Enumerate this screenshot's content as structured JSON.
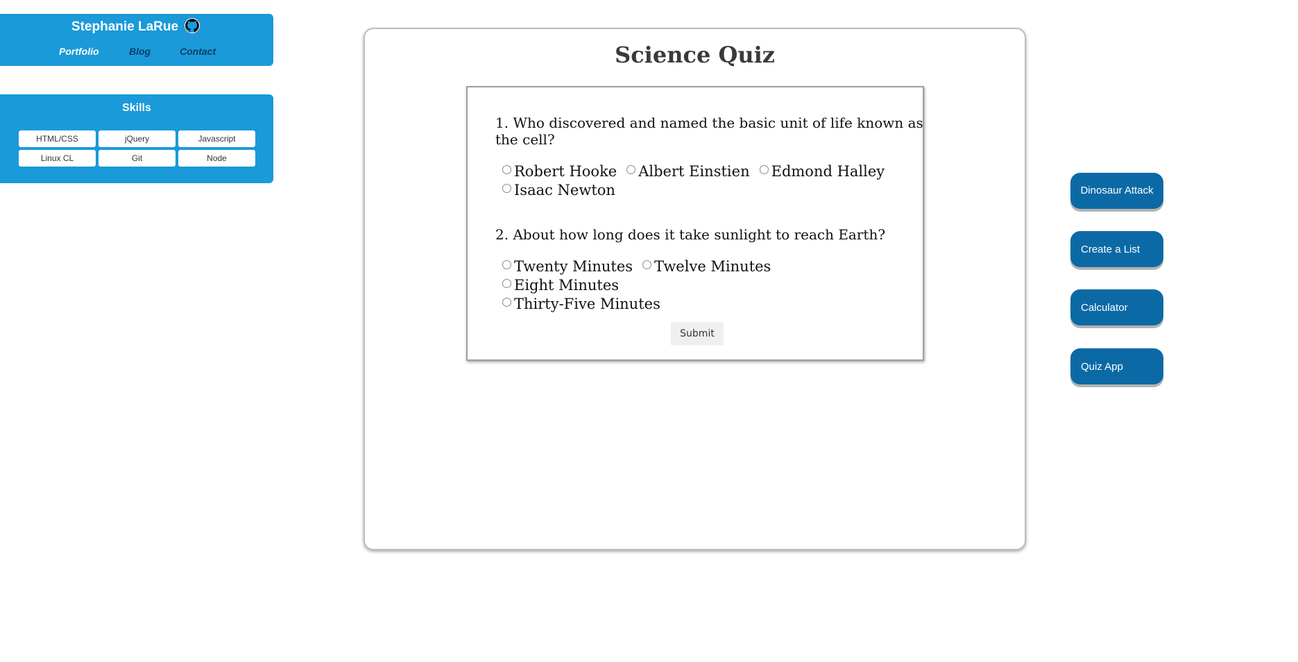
{
  "header": {
    "name": "Stephanie LaRue",
    "github_icon": "github-icon",
    "nav": [
      {
        "label": "Portfolio"
      },
      {
        "label": "Blog"
      },
      {
        "label": "Contact"
      }
    ]
  },
  "skills": {
    "title": "Skills",
    "items": [
      "HTML/CSS",
      "jQuery",
      "Javascript",
      "Linux CL",
      "Git",
      "Node"
    ]
  },
  "quiz": {
    "title": "Science Quiz",
    "questions": [
      {
        "text": "1. Who discovered and named the basic unit of life known as the cell?",
        "options": [
          "Robert Hooke",
          "Albert Einstien",
          "Edmond Halley",
          "Isaac Newton"
        ]
      },
      {
        "text": "2. About how long does it take sunlight to reach Earth?",
        "options": [
          "Twenty Minutes",
          "Twelve Minutes",
          "Eight Minutes",
          "Thirty-Five Minutes"
        ]
      }
    ],
    "submit_label": "Submit"
  },
  "apps": [
    {
      "label": "Dinosaur Attack"
    },
    {
      "label": "Create a List"
    },
    {
      "label": "Calculator"
    },
    {
      "label": "Quiz App"
    }
  ],
  "colors": {
    "card_blue": "#1a9ad9",
    "button_blue": "#0b6aa5",
    "nav_dark": "#0b3f66"
  }
}
